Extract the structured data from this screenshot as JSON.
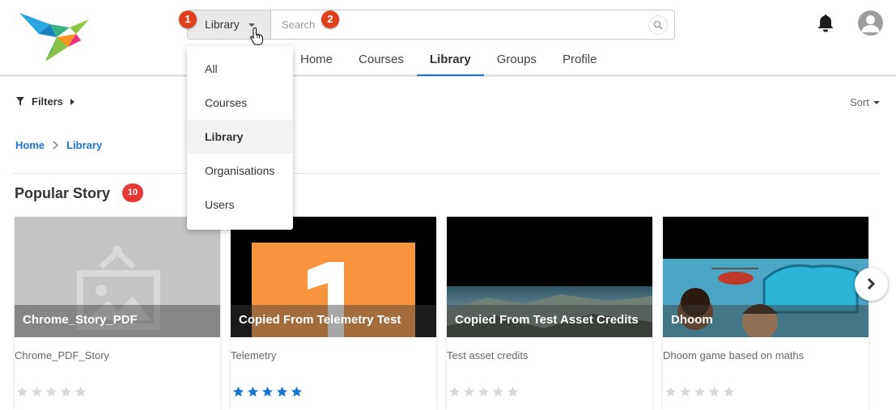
{
  "header": {
    "search": {
      "selected_filter": "Library",
      "placeholder": "Search"
    },
    "markers": [
      "1",
      "2"
    ],
    "nav_tabs": [
      {
        "label": "Home",
        "active": false
      },
      {
        "label": "Courses",
        "active": false
      },
      {
        "label": "Library",
        "active": true
      },
      {
        "label": "Groups",
        "active": false
      },
      {
        "label": "Profile",
        "active": false
      }
    ],
    "icons": {
      "logo": "bird-logo",
      "notifications": "bell-icon",
      "user": "avatar-icon",
      "search": "search-icon"
    }
  },
  "dropdown": {
    "items": [
      {
        "label": "All",
        "selected": false
      },
      {
        "label": "Courses",
        "selected": false
      },
      {
        "label": "Library",
        "selected": true
      },
      {
        "label": "Organisations",
        "selected": false
      },
      {
        "label": "Users",
        "selected": false
      }
    ]
  },
  "toolbar": {
    "filters_label": "Filters",
    "sort_label": "Sort"
  },
  "breadcrumb": {
    "items": [
      "Home",
      "Library"
    ]
  },
  "section": {
    "title": "Popular Story",
    "count": "10"
  },
  "cards": [
    {
      "title": "Chrome_Story_PDF",
      "description": "Chrome_PDF_Story",
      "rating": 0,
      "thumbnail": "placeholder-image"
    },
    {
      "title": "Copied From Telemetry Test",
      "description": "Telemetry",
      "rating": 5,
      "thumbnail": "orange-number-one"
    },
    {
      "title": "Copied From Test Asset Credits",
      "description": "Test asset credits",
      "rating": 0,
      "thumbnail": "mountain-landscape"
    },
    {
      "title": "Dhoom",
      "description": "Dhoom game based on maths",
      "rating": 0,
      "thumbnail": "dhoom-game-art"
    }
  ],
  "colors": {
    "accent": "#1976d2",
    "marker": "#e2401c",
    "badge": "#e53935",
    "star_filled": "#1976d2",
    "star_empty": "#d8d8d8"
  }
}
